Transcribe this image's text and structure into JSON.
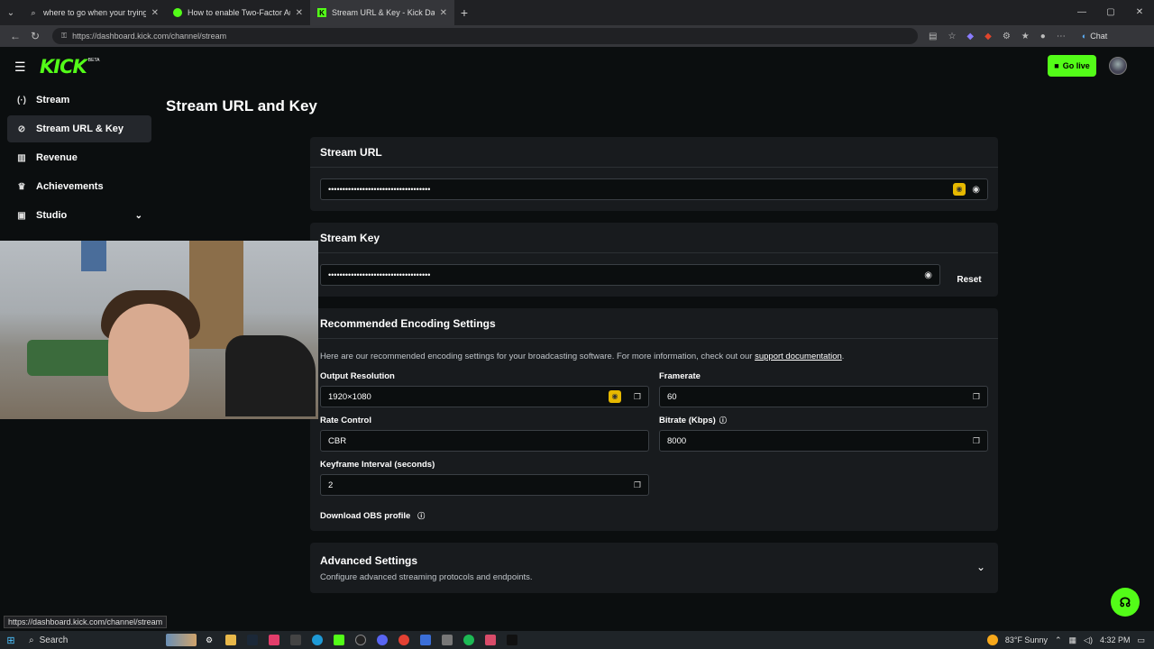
{
  "browser": {
    "tabs": [
      {
        "title": "where to go when your trying to g",
        "active": false
      },
      {
        "title": "How to enable Two-Factor Authen",
        "active": false
      },
      {
        "title": "Stream URL & Key - Kick Dashboa",
        "active": true
      }
    ],
    "new_tab": "+",
    "url": "https://dashboard.kick.com/channel/stream",
    "chat_label": "Chat",
    "status_url": "https://dashboard.kick.com/channel/stream"
  },
  "app": {
    "logo": "KICK",
    "beta": "BETA",
    "go_live_label": "Go live"
  },
  "sidebar": {
    "items": [
      {
        "label": "Stream",
        "icon": "broadcast-icon"
      },
      {
        "label": "Stream URL & Key",
        "icon": "link-icon"
      },
      {
        "label": "Revenue",
        "icon": "chart-icon"
      },
      {
        "label": "Achievements",
        "icon": "trophy-icon"
      },
      {
        "label": "Studio",
        "icon": "studio-icon"
      }
    ]
  },
  "page": {
    "title": "Stream URL and Key"
  },
  "stream_url": {
    "heading": "Stream URL",
    "value": "••••••••••••••••••••••••••••••••••••"
  },
  "stream_key": {
    "heading": "Stream Key",
    "value": "••••••••••••••••••••••••••••••••••••",
    "reset_label": "Reset"
  },
  "encoding": {
    "heading": "Recommended Encoding Settings",
    "description": "Here are our recommended encoding settings for your broadcasting software. For more information, check out our",
    "link_text": "support documentation",
    "period": ".",
    "output_resolution": {
      "label": "Output Resolution",
      "value": "1920×1080"
    },
    "framerate": {
      "label": "Framerate",
      "value": "60"
    },
    "rate_control": {
      "label": "Rate Control",
      "value": "CBR"
    },
    "bitrate": {
      "label": "Bitrate (Kbps)",
      "value": "8000"
    },
    "keyframe": {
      "label": "Keyframe Interval (seconds)",
      "value": "2"
    },
    "download_label": "Download OBS profile"
  },
  "advanced": {
    "title": "Advanced Settings",
    "subtitle": "Configure advanced streaming protocols and endpoints."
  },
  "taskbar": {
    "search": "Search",
    "weather": "83°F  Sunny",
    "time": "4:32 PM"
  },
  "colors": {
    "brand": "#53fc18",
    "background": "#0b0e0f",
    "card": "#181b1e"
  }
}
